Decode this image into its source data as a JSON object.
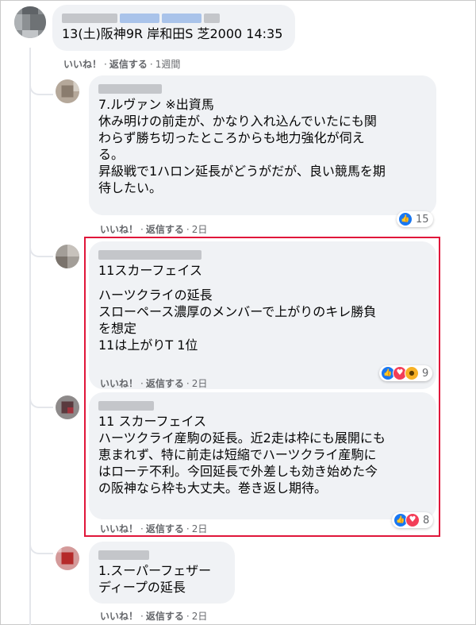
{
  "comments": [
    {
      "text": "13(土)阪神9R 岸和田S 芝2000 14:35",
      "like": "いいね！",
      "reply": "返信する",
      "time": "1週間"
    },
    {
      "text": "7.ルヴァン ※出資馬\n休み明けの前走が、かなり入れ込んでいたにも関\nわらず勝ち切ったところからも地力強化が伺え\nる。\n昇級戦で1ハロン延長がどうがだが、良い競馬を期\n待したい。",
      "like": "いいね！",
      "reply": "返信する",
      "time": "2日",
      "reaction_count": "15",
      "reactions": [
        "like"
      ]
    },
    {
      "text_a": "11スカーフェイス",
      "text_b": "ハーツクライの延長\nスローペース濃厚のメンバーで上がりのキレ勝負\nを想定\n11は上がりT 1位",
      "like": "いいね！",
      "reply": "返信する",
      "time": "2日",
      "reaction_count": "9",
      "reactions": [
        "like",
        "love",
        "wow"
      ]
    },
    {
      "text": "11 スカーフェイス\nハーツクライ産駒の延長。近2走は枠にも展開にも\n恵まれず、特に前走は短縮でハーツクライ産駒に\nはローテ不利。今回延長で外差しも効き始めた今\nの阪神なら枠も大丈夫。巻き返し期待。",
      "like": "いいね！",
      "reply": "返信する",
      "time": "2日",
      "reaction_count": "8",
      "reactions": [
        "like",
        "love"
      ]
    },
    {
      "text": "1.スーパーフェザー\nディープの延長",
      "like": "いいね！",
      "reply": "返信する",
      "time": "2日"
    }
  ],
  "colors": {
    "highlight": "#e0163a",
    "bubble": "#f0f2f5",
    "like": "#1877f2",
    "love": "#f33e58",
    "wow": "#f7b125"
  }
}
